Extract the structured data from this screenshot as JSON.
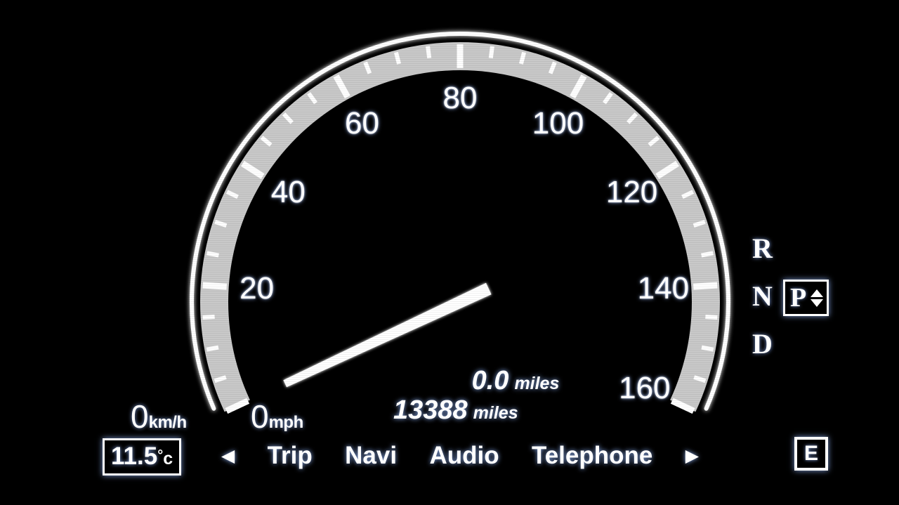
{
  "display": {
    "name": "instrument-cluster",
    "background_color": "#000000",
    "band_color": "#c9c9c9",
    "accent_color": "#ffffff",
    "glow_color": "#96b9ff"
  },
  "speedometer": {
    "type": "gauge",
    "unit_primary": "mph",
    "unit_secondary": "km/h",
    "min": 0,
    "max": 160,
    "major_step": 20,
    "minor_step": 5,
    "current_value": 0,
    "tick_labels": [
      "20",
      "40",
      "60",
      "80",
      "100",
      "120",
      "140",
      "160"
    ],
    "tick_values": [
      20,
      40,
      60,
      80,
      100,
      120,
      140,
      160
    ],
    "needle_value": 0,
    "kmh_readout": {
      "value": "0",
      "unit": "km/h"
    },
    "mph_readout": {
      "value": "0",
      "unit": "mph"
    }
  },
  "odometer": {
    "trip": {
      "value": "0.0",
      "unit": "miles"
    },
    "total": {
      "value": "13388",
      "unit": "miles"
    }
  },
  "menu": {
    "left_arrow": "◀",
    "right_arrow": "▶",
    "items": [
      {
        "label": "Trip"
      },
      {
        "label": "Navi"
      },
      {
        "label": "Audio"
      },
      {
        "label": "Telephone"
      }
    ]
  },
  "temperature": {
    "value": "11.5",
    "degree": "°",
    "unit": "c"
  },
  "gear_selector": {
    "positions": [
      "R",
      "N",
      "D"
    ],
    "current": "P",
    "up_arrow": "▲",
    "down_arrow": "▼"
  },
  "fuel": {
    "empty_label": "E"
  },
  "chart_data": {
    "type": "gauge",
    "title": "Speedometer",
    "unit": "mph",
    "min": 0,
    "max": 160,
    "major_step": 20,
    "minor_step": 5,
    "value": 0,
    "tick_labels": [
      "20",
      "40",
      "60",
      "80",
      "100",
      "120",
      "140",
      "160"
    ],
    "start_angle_deg": 205,
    "end_angle_deg": -25,
    "grid": false,
    "legend": "none"
  }
}
